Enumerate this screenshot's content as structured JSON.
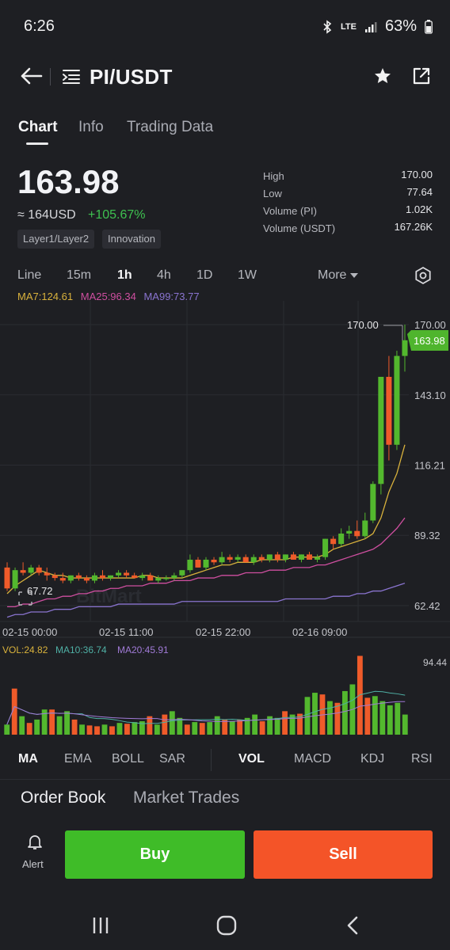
{
  "status_bar": {
    "time": "6:26",
    "network": "LTE",
    "battery": "63%"
  },
  "header": {
    "pair": "PI/USDT"
  },
  "tabs": [
    "Chart",
    "Info",
    "Trading Data"
  ],
  "ticker": {
    "price": "163.98",
    "approx": "≈ 164USD",
    "change": "+105.67%",
    "tags": [
      "Layer1/Layer2",
      "Innovation"
    ],
    "stats": [
      {
        "label": "High",
        "value": "170.00"
      },
      {
        "label": "Low",
        "value": "77.64"
      },
      {
        "label": "Volume (PI)",
        "value": "1.02K"
      },
      {
        "label": "Volume (USDT)",
        "value": "167.26K"
      }
    ]
  },
  "intervals": [
    "Line",
    "15m",
    "1h",
    "4h",
    "1D",
    "1W"
  ],
  "more_label": "More",
  "ma_legend": {
    "ma7": "MA7:124.61",
    "ma25": "MA25:96.34",
    "ma99": "MA99:73.77"
  },
  "colors": {
    "up": "#53b82e",
    "down": "#ef5b2a",
    "ma7": "#d9b23c",
    "ma25": "#cf4fa0",
    "ma99": "#8a74d0",
    "buy": "#3fbc28",
    "sell": "#f45428"
  },
  "chart_data": {
    "type": "candlestick",
    "price_axis": [
      "170.00",
      "143.10",
      "116.21",
      "89.32",
      "62.42"
    ],
    "time_axis": [
      "02-15 00:00",
      "02-15 11:00",
      "02-15 22:00",
      "02-16 09:00"
    ],
    "high_label": "170.00",
    "low_label": "67.72",
    "current_price": "163.98",
    "watermark": "BitMart",
    "ohlc": [
      [
        77,
        79,
        68,
        69
      ],
      [
        69,
        77,
        68,
        76
      ],
      [
        76,
        79,
        74,
        75
      ],
      [
        75,
        78,
        74,
        77
      ],
      [
        77,
        78,
        74,
        75
      ],
      [
        75,
        77,
        72,
        74
      ],
      [
        74,
        75,
        72,
        73
      ],
      [
        73,
        75,
        71,
        72
      ],
      [
        72,
        74,
        71,
        74
      ],
      [
        74,
        75,
        72,
        73
      ],
      [
        73,
        74,
        71,
        72
      ],
      [
        72,
        75,
        71,
        74
      ],
      [
        74,
        76,
        72,
        73
      ],
      [
        73,
        74,
        72,
        74
      ],
      [
        74,
        76,
        73,
        75
      ],
      [
        75,
        76,
        73,
        74
      ],
      [
        74,
        75,
        73,
        73
      ],
      [
        73,
        75,
        72,
        74
      ],
      [
        74,
        75,
        72,
        72
      ],
      [
        72,
        74,
        71,
        73
      ],
      [
        73,
        74,
        72,
        73
      ],
      [
        73,
        75,
        72,
        74
      ],
      [
        74,
        76,
        73,
        76
      ],
      [
        76,
        82,
        75,
        80
      ],
      [
        80,
        81,
        77,
        77
      ],
      [
        77,
        81,
        76,
        80
      ],
      [
        80,
        81,
        78,
        79
      ],
      [
        79,
        83,
        78,
        81
      ],
      [
        81,
        82,
        79,
        80
      ],
      [
        80,
        82,
        79,
        81
      ],
      [
        81,
        82,
        79,
        79
      ],
      [
        79,
        82,
        78,
        81
      ],
      [
        81,
        82,
        79,
        80
      ],
      [
        80,
        82,
        79,
        82
      ],
      [
        82,
        83,
        79,
        80
      ],
      [
        80,
        82,
        79,
        82
      ],
      [
        82,
        83,
        80,
        80
      ],
      [
        80,
        82,
        79,
        82
      ],
      [
        82,
        83,
        80,
        80
      ],
      [
        80,
        82,
        79,
        81
      ],
      [
        81,
        88,
        80,
        88
      ],
      [
        88,
        89,
        84,
        86
      ],
      [
        86,
        92,
        85,
        90
      ],
      [
        90,
        93,
        88,
        91
      ],
      [
        91,
        95,
        88,
        89
      ],
      [
        89,
        98,
        88,
        95
      ],
      [
        95,
        110,
        94,
        109
      ],
      [
        109,
        150,
        105,
        150
      ],
      [
        150,
        158,
        118,
        124
      ],
      [
        124,
        160,
        122,
        158
      ],
      [
        158,
        170,
        152,
        164
      ]
    ],
    "ma_lines": {
      "MA7": [
        67,
        70,
        72,
        74,
        76,
        75,
        74,
        74,
        73,
        73,
        73,
        73,
        73,
        73,
        73,
        73,
        73,
        74,
        74,
        73,
        73,
        73,
        73,
        74,
        75,
        76,
        77,
        78,
        78,
        79,
        79,
        79,
        80,
        80,
        80,
        80,
        81,
        81,
        81,
        81,
        82,
        84,
        85,
        86,
        87,
        88,
        90,
        96,
        106,
        113,
        124
      ],
      "MA25": [
        62,
        62,
        63,
        63,
        64,
        65,
        65,
        66,
        66,
        67,
        67,
        68,
        68,
        69,
        69,
        70,
        70,
        70,
        71,
        71,
        71,
        72,
        72,
        72,
        73,
        73,
        73,
        74,
        74,
        74,
        75,
        75,
        75,
        76,
        76,
        76,
        77,
        77,
        77,
        78,
        78,
        79,
        80,
        81,
        82,
        83,
        84,
        86,
        89,
        92,
        96
      ],
      "MA99": [
        58,
        59,
        59,
        60,
        60,
        60,
        61,
        61,
        61,
        62,
        62,
        62,
        62,
        62,
        63,
        63,
        63,
        63,
        63,
        63,
        63,
        63,
        64,
        64,
        64,
        64,
        64,
        64,
        64,
        64,
        64,
        64,
        64,
        64,
        64,
        65,
        65,
        65,
        65,
        65,
        65,
        66,
        66,
        66,
        67,
        67,
        68,
        68,
        69,
        70,
        71
      ]
    },
    "volume": {
      "legend": {
        "vol": "VOL:24.82",
        "ma10": "MA10:36.74",
        "ma20": "MA20:45.91"
      },
      "max_label": "94.44",
      "values": [
        12,
        55,
        22,
        14,
        18,
        30,
        30,
        22,
        28,
        18,
        12,
        11,
        10,
        12,
        10,
        14,
        13,
        15,
        16,
        22,
        12,
        24,
        28,
        20,
        12,
        15,
        14,
        15,
        22,
        18,
        16,
        18,
        20,
        24,
        16,
        22,
        20,
        28,
        24,
        25,
        45,
        50,
        48,
        40,
        38,
        52,
        60,
        94,
        44,
        46,
        40,
        35,
        38,
        24
      ],
      "up": [
        1,
        0,
        1,
        0,
        1,
        1,
        0,
        1,
        1,
        0,
        1,
        0,
        0,
        1,
        0,
        1,
        0,
        1,
        1,
        0,
        1,
        0,
        1,
        1,
        0,
        1,
        0,
        1,
        1,
        0,
        1,
        0,
        1,
        1,
        0,
        1,
        1,
        0,
        1,
        0,
        1,
        1,
        0,
        1,
        0,
        1,
        1,
        0,
        0,
        1,
        1,
        1,
        1,
        1
      ]
    }
  },
  "indicators_left": [
    "MA",
    "EMA",
    "BOLL",
    "SAR"
  ],
  "indicators_right": [
    "VOL",
    "MACD",
    "KDJ",
    "RSI"
  ],
  "bottom_tabs": [
    "Order Book",
    "Market Trades"
  ],
  "actions": {
    "alert": "Alert",
    "buy": "Buy",
    "sell": "Sell"
  }
}
